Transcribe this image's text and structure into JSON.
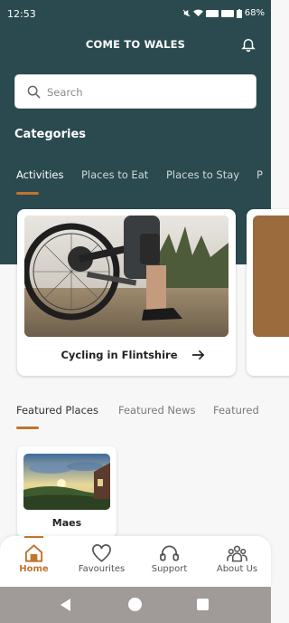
{
  "status_bar": {
    "time": "12:53",
    "battery": "68%"
  },
  "app_bar": {
    "title": "COME TO WALES"
  },
  "search": {
    "placeholder": "Search"
  },
  "categories": {
    "title": "Categories",
    "tabs": [
      "Activities",
      "Places to Eat",
      "Places to Stay",
      "P"
    ],
    "active_tab": "Activities"
  },
  "activity_cards": [
    {
      "title": "Cycling in Flintshire"
    },
    {
      "title": ""
    }
  ],
  "featured": {
    "tabs": [
      "Featured Places",
      "Featured News",
      "Featured"
    ],
    "active_tab": "Featured Places",
    "places": [
      {
        "title": "Maes"
      }
    ]
  },
  "bottom_nav": {
    "items": [
      {
        "label": "Home",
        "icon": "home-icon"
      },
      {
        "label": "Favourites",
        "icon": "heart-icon"
      },
      {
        "label": "Support",
        "icon": "headset-icon"
      },
      {
        "label": "About Us",
        "icon": "group-icon"
      }
    ],
    "active": "Home"
  },
  "colors": {
    "header": "#2a4a4f",
    "accent": "#c0742e",
    "system_nav": "#a09a99"
  }
}
